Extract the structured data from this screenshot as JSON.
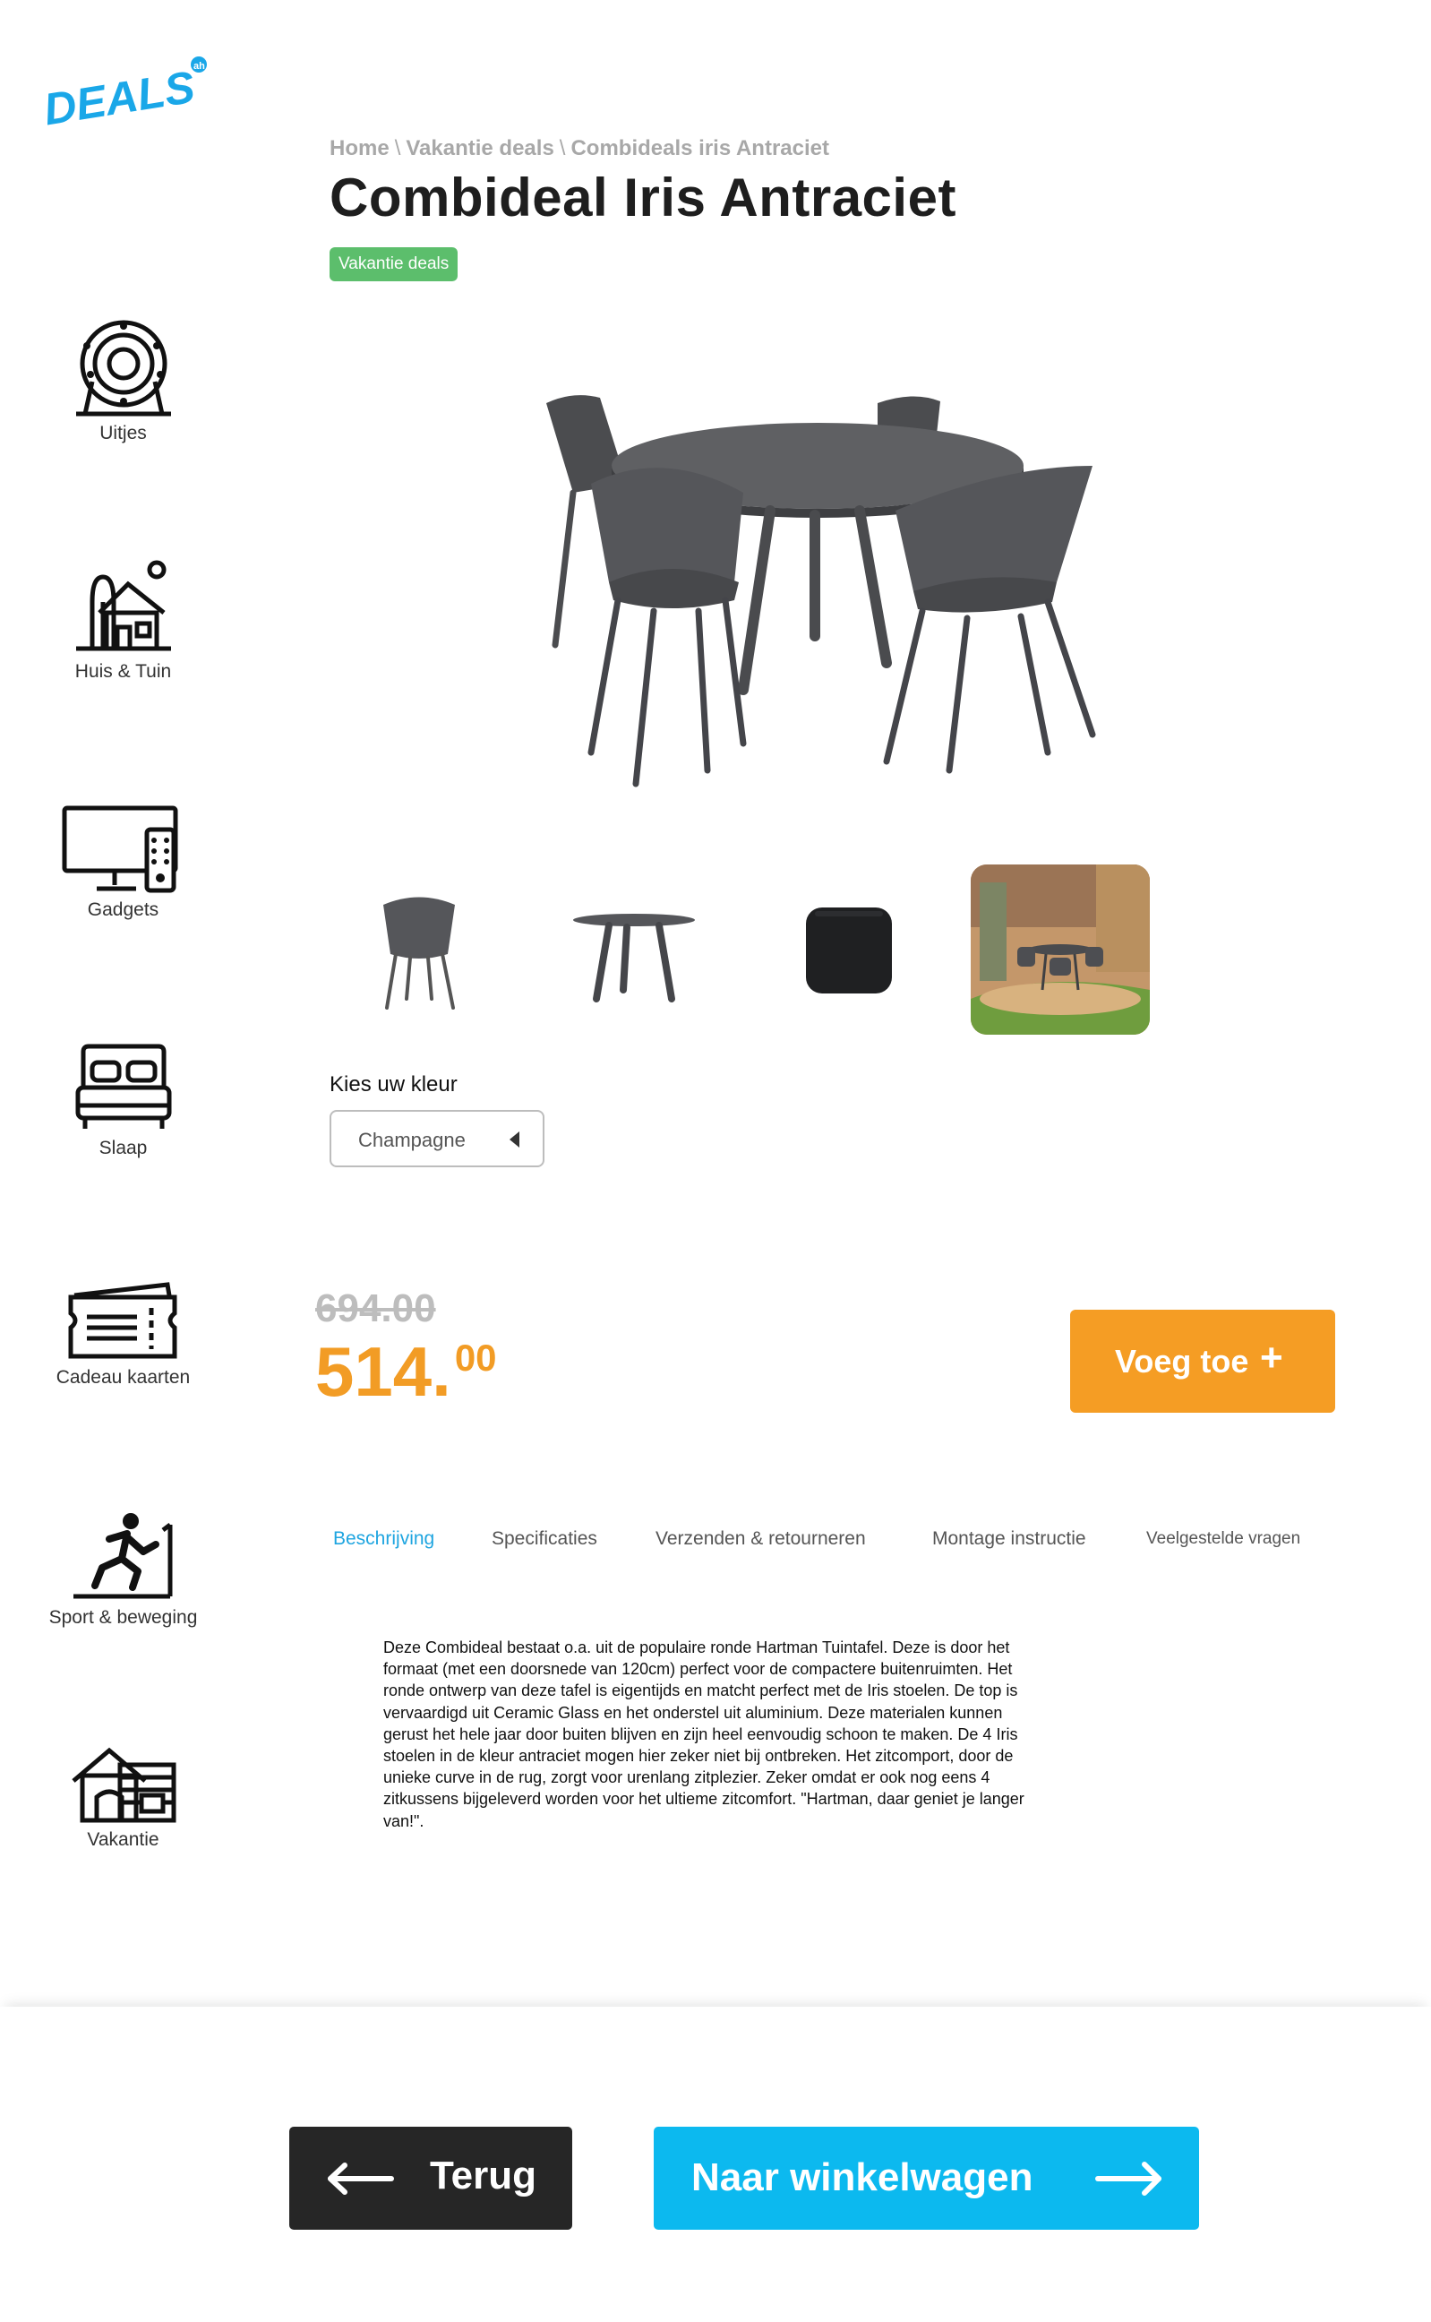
{
  "logo": {
    "text": "DEALS",
    "badge": "ah"
  },
  "sidebar": {
    "items": [
      {
        "label": "Uitjes",
        "icon": "ferris-wheel-icon"
      },
      {
        "label": "Huis & Tuin",
        "icon": "house-tree-icon"
      },
      {
        "label": "Gadgets",
        "icon": "tv-remote-icon"
      },
      {
        "label": "Slaap",
        "icon": "bed-icon"
      },
      {
        "label": "Cadeau kaarten",
        "icon": "gift-card-icon"
      },
      {
        "label": "Sport & beweging",
        "icon": "treadmill-runner-icon"
      },
      {
        "label": "Vakantie",
        "icon": "cabin-icon"
      }
    ]
  },
  "breadcrumb": {
    "items": [
      "Home",
      "Vakantie deals",
      "Combideals iris Antraciet"
    ],
    "separator": "\\"
  },
  "product": {
    "title": "Combideal Iris Antraciet",
    "badge": "Vakantie deals",
    "main_image": "round-table-with-four-chairs",
    "thumbnails": [
      "chair",
      "table",
      "cushion",
      "patio-scene"
    ]
  },
  "color": {
    "label": "Kies uw kleur",
    "selected": "Champagne"
  },
  "price": {
    "old": "694.00",
    "integer": "514.",
    "decimals": "00"
  },
  "add_button": {
    "label": "Voeg toe",
    "icon": "plus-icon"
  },
  "tabs": [
    {
      "label": "Beschrijving",
      "active": true
    },
    {
      "label": "Specificaties",
      "active": false
    },
    {
      "label": "Verzenden & retourneren",
      "active": false
    },
    {
      "label": "Montage instructie",
      "active": false
    },
    {
      "label": "Veelgestelde vragen",
      "active": false
    }
  ],
  "description": "Deze Combideal bestaat o.a. uit de populaire ronde Hartman Tuintafel. Deze is door het formaat (met een doorsnede van 120cm) perfect voor de compactere buitenruimten. Het ronde ontwerp van deze tafel is eigentijds en matcht perfect met de Iris stoelen. De top is vervaardigd uit Ceramic Glass en het onderstel uit aluminium. Deze materialen kunnen gerust het hele jaar door buiten blijven en zijn heel eenvoudig schoon te maken. De 4 Iris stoelen in de kleur antraciet mogen hier zeker niet bij ontbreken. Het zitcomport, door de unieke curve in de rug, zorgt voor urenlang zitplezier. Zeker omdat er ook nog eens 4 zitkussens bijgeleverd worden voor het ultieme zitcomfort. \"Hartman, daar geniet je langer van!\".",
  "footer": {
    "back_label": "Terug",
    "cart_label": "Naar winkelwagen"
  },
  "colors": {
    "accent_orange": "#f59d24",
    "accent_blue": "#0cb9ef",
    "badge_green": "#5cbe6c",
    "tab_active": "#1ea5e0"
  }
}
